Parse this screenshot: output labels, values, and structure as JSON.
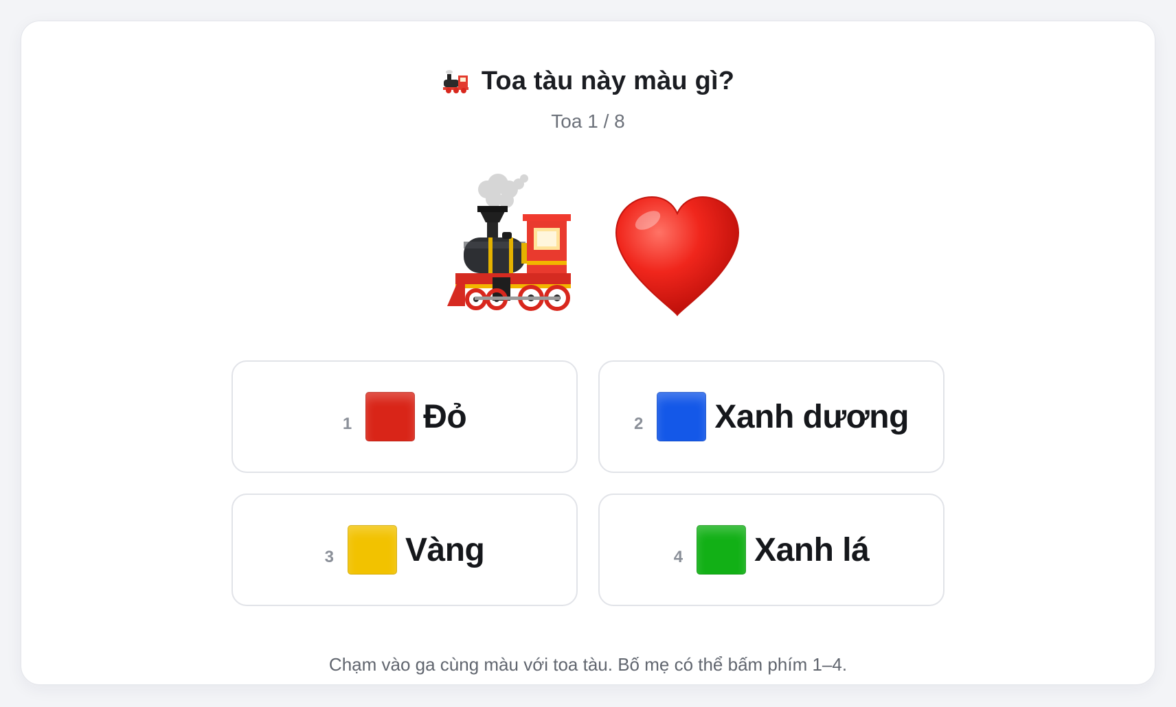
{
  "header": {
    "title_icon": "locomotive-icon",
    "title": "Toa tàu này màu gì?",
    "progress": "Toa 1 / 8"
  },
  "stage": {
    "train_icon": "steam-locomotive-icon",
    "car_icon": "red-heart-icon",
    "car_color": "#e0261f"
  },
  "options": [
    {
      "number": "1",
      "label": "Đỏ",
      "color": "#d92518",
      "icon": "red-square-icon"
    },
    {
      "number": "2",
      "label": "Xanh dương",
      "color": "#1458e8",
      "icon": "blue-square-icon"
    },
    {
      "number": "3",
      "label": "Vàng",
      "color": "#f2c200",
      "icon": "yellow-square-icon"
    },
    {
      "number": "4",
      "label": "Xanh lá",
      "color": "#12b016",
      "icon": "green-square-icon"
    }
  ],
  "footer": {
    "hint": "Chạm vào ga cùng màu với toa tàu. Bố mẹ có thể bấm phím 1–4."
  }
}
